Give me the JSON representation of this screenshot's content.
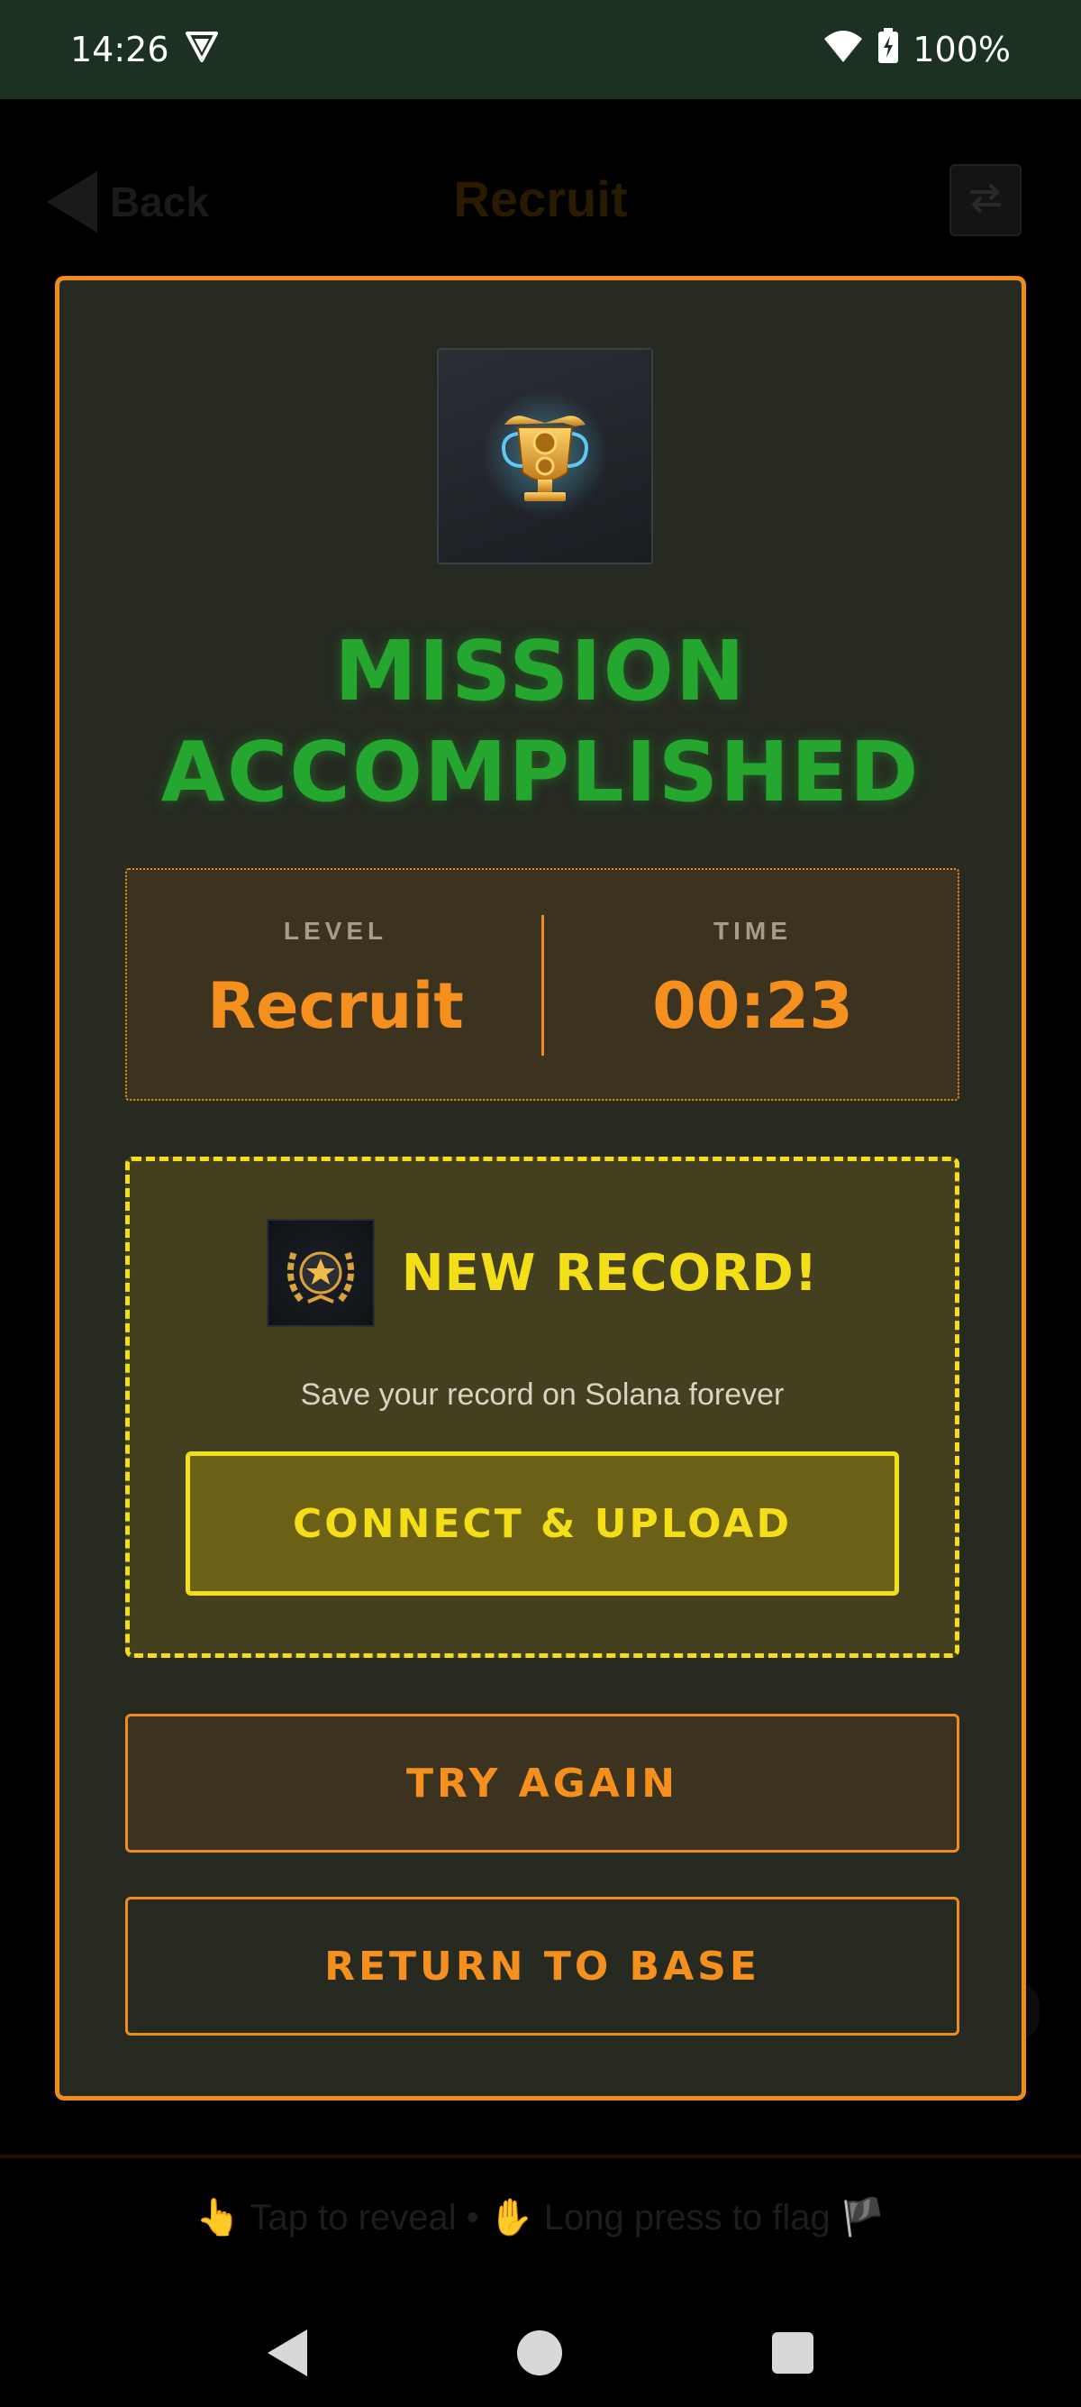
{
  "status_bar": {
    "time": "14:26",
    "battery": "100%"
  },
  "app_header": {
    "back_label": "Back",
    "title": "Recruit"
  },
  "bottom_hint": "👆 Tap to reveal • ✋ Long press to flag 🏴",
  "modal": {
    "title_line1": "MISSION",
    "title_line2": "ACCOMPLISHED",
    "stats": {
      "level_label": "LEVEL",
      "level_value": "Recruit",
      "time_label": "TIME",
      "time_value": "00:23"
    },
    "record": {
      "title": "NEW RECORD!",
      "subtitle": "Save your record on Solana forever",
      "connect_label": "CONNECT & UPLOAD"
    },
    "try_again_label": "TRY AGAIN",
    "return_label": "RETURN TO BASE"
  },
  "colors": {
    "accent_orange": "#f08c1a",
    "success_green": "#24a62f",
    "record_yellow": "#f4de18",
    "modal_bg": "#262a21"
  }
}
